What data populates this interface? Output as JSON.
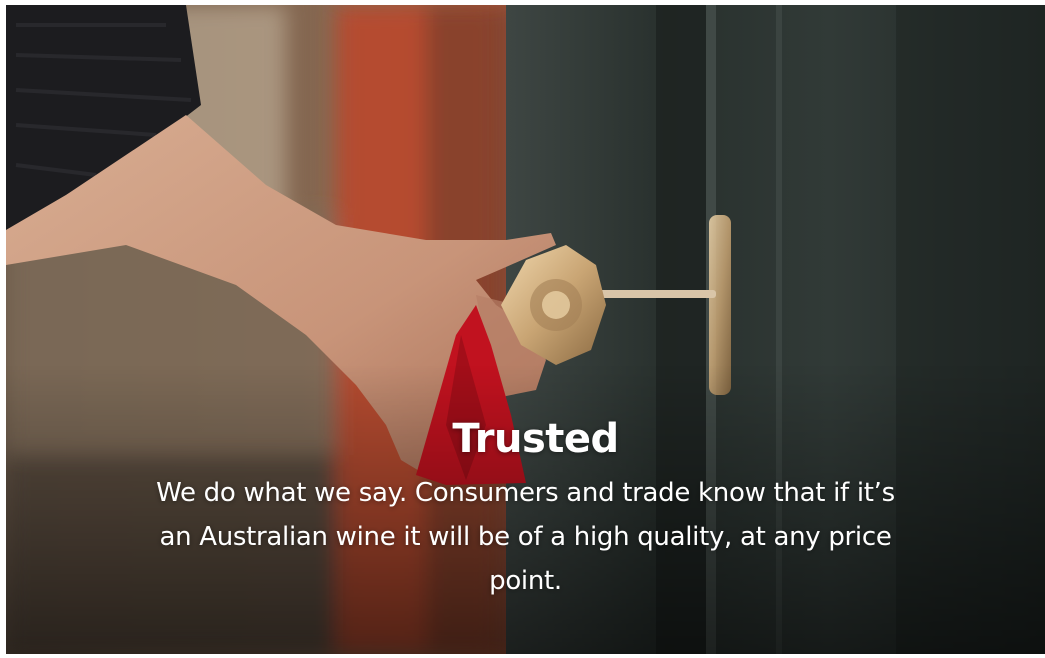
{
  "hero": {
    "image_label": "hand-turning-ornate-key-in-door",
    "title": "Trusted",
    "body": "We do what we say. Consumers and trade know that if it’s an Australian wine it will be of a high quality, at any price point."
  },
  "colors": {
    "text": "#ffffff",
    "door": "#2c3431",
    "red_wall": "#b8472b",
    "tassel": "#c1121f",
    "key_gold": "#d9b98a"
  }
}
